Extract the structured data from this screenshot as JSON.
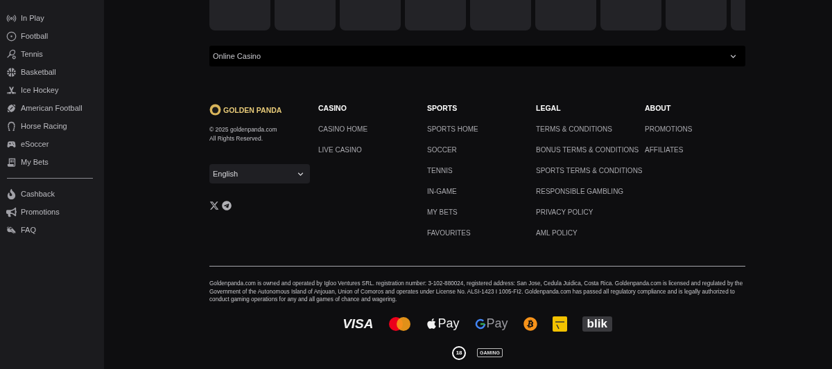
{
  "sidebar": {
    "items": [
      {
        "label": "In Play"
      },
      {
        "label": "Football"
      },
      {
        "label": "Tennis"
      },
      {
        "label": "Basketball"
      },
      {
        "label": "Ice Hockey"
      },
      {
        "label": "American Football"
      },
      {
        "label": "Horse Racing"
      },
      {
        "label": "eSoccer"
      },
      {
        "label": "My Bets"
      }
    ],
    "extra_items": [
      {
        "label": "Cashback"
      },
      {
        "label": "Promotions"
      },
      {
        "label": "FAQ"
      }
    ]
  },
  "category_select": {
    "value": "Online Casino"
  },
  "footer": {
    "brand": "GOLDEN PANDA",
    "copyright": "© 2025 goldenpanda.com",
    "rights": "All Rights Reserved.",
    "language": "English",
    "columns": [
      {
        "title": "CASINO",
        "links": [
          "CASINO HOME",
          "LIVE CASINO"
        ]
      },
      {
        "title": "SPORTS",
        "links": [
          "SPORTS HOME",
          "SOCCER",
          "TENNIS",
          "IN-GAME",
          "MY BETS",
          "FAVOURITES"
        ]
      },
      {
        "title": "LEGAL",
        "links": [
          "TERMS & CONDITIONS",
          "BONUS TERMS & CONDITIONS",
          "SPORTS TERMS & CONDITIONS",
          "RESPONSIBLE GAMBLING",
          "PRIVACY POLICY",
          "AML POLICY"
        ]
      },
      {
        "title": "ABOUT",
        "links": [
          "PROMOTIONS",
          "AFFILIATES"
        ]
      }
    ],
    "legal_text": "Goldenpanda.com is owned and operated by Igloo Ventures SRL. registration number: 3-102-880024, registered address: San Jose, Cedula Juidica, Costa Rica. Goldenpanda.com is licensed and regulated by the Government of the Autonomous Island of Anjouan, Union of Comoros and operates under License No. ALSI-1423 I 1005-FI2. Goldenpanda.com has passed all regulatory compliance and is legally authorized to conduct gaming operations for any and all games of chance and wagering.",
    "payments": [
      {
        "kind": "visa",
        "label": "VISA"
      },
      {
        "kind": "mastercard"
      },
      {
        "kind": "applepay",
        "label": "Pay"
      },
      {
        "kind": "googlepay",
        "label": "Pay"
      },
      {
        "kind": "bitcoin"
      },
      {
        "kind": "interac"
      },
      {
        "kind": "blik",
        "label": "blik"
      }
    ],
    "badges": [
      {
        "kind": "age",
        "label": "18"
      },
      {
        "kind": "rg",
        "label": "GAMING"
      }
    ]
  }
}
